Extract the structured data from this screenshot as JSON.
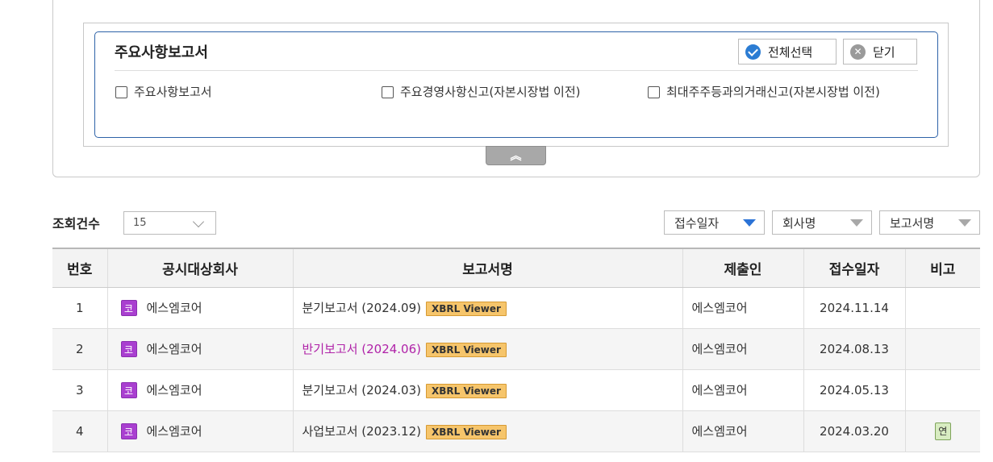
{
  "filter": {
    "title": "주요사항보고서",
    "select_all_label": "전체선택",
    "close_label": "닫기",
    "options": [
      "주요사항보고서",
      "주요경영사항신고(자본시장법 이전)",
      "최대주주등과의거래신고(자본시장법 이전)"
    ]
  },
  "icons": {
    "check": "check-circle-icon",
    "close": "x-circle-icon",
    "collapse": "double-chevron-up-icon",
    "dropdown": "chevron-down-icon",
    "sort": "triangle-down-icon"
  },
  "results": {
    "count_label": "조회건수",
    "page_size": "15",
    "sort_options": [
      "접수일자",
      "회사명",
      "보고서명"
    ],
    "active_sort": "접수일자"
  },
  "table": {
    "headers": [
      "번호",
      "공시대상회사",
      "보고서명",
      "제출인",
      "접수일자",
      "비고"
    ],
    "rows": [
      {
        "no": "1",
        "market": "코",
        "company": "에스엠코어",
        "report": "분기보고서 (2024.09)",
        "viewer": "XBRL Viewer",
        "submitter": "에스엠코어",
        "date": "2024.11.14",
        "remark": ""
      },
      {
        "no": "2",
        "market": "코",
        "company": "에스엠코어",
        "report": "반기보고서 (2024.06)",
        "viewer": "XBRL Viewer",
        "submitter": "에스엠코어",
        "date": "2024.08.13",
        "remark": ""
      },
      {
        "no": "3",
        "market": "코",
        "company": "에스엠코어",
        "report": "분기보고서 (2024.03)",
        "viewer": "XBRL Viewer",
        "submitter": "에스엠코어",
        "date": "2024.05.13",
        "remark": ""
      },
      {
        "no": "4",
        "market": "코",
        "company": "에스엠코어",
        "report": "사업보고서 (2023.12)",
        "viewer": "XBRL Viewer",
        "submitter": "에스엠코어",
        "date": "2024.03.20",
        "remark": "연"
      }
    ]
  },
  "colors": {
    "accent": "#2b73d6",
    "market_badge": "#a93fd0",
    "visited_link": "#b022a8",
    "xbrl_badge": "#f6c56b"
  }
}
